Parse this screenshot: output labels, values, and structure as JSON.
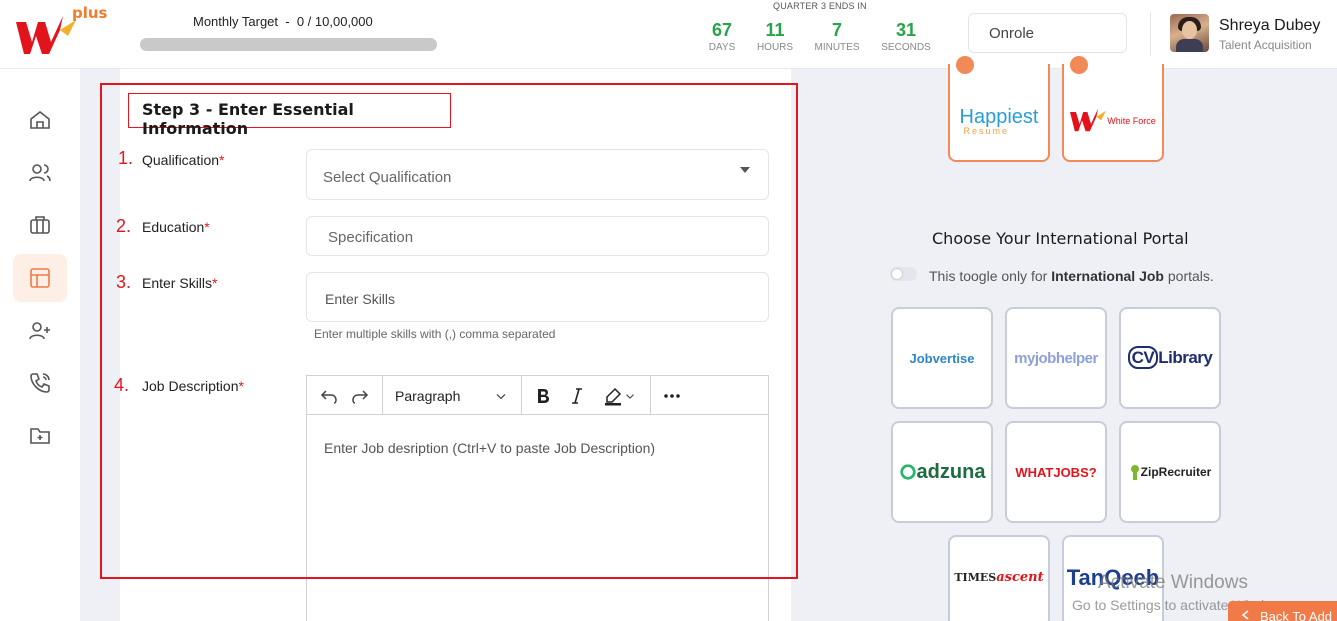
{
  "header": {
    "logo_plus": "plus",
    "target_label": "Monthly Target",
    "target_separator": "-",
    "target_value": "0 / 10,00,000",
    "target_progress": 0,
    "quarter_label": "QUARTER 3 ENDS IN",
    "countdown": [
      {
        "value": "67",
        "unit": "DAYS"
      },
      {
        "value": "11",
        "unit": "HOURS"
      },
      {
        "value": "7",
        "unit": "MINUTES"
      },
      {
        "value": "31",
        "unit": "SECONDS"
      }
    ],
    "search_text": "Onrole",
    "user_name": "Shreya Dubey",
    "user_role": "Talent Acquisition"
  },
  "sidebar": {
    "items": [
      {
        "icon": "home-icon"
      },
      {
        "icon": "users-icon"
      },
      {
        "icon": "briefcase-icon"
      },
      {
        "icon": "layout-icon",
        "active": true
      },
      {
        "icon": "user-plus-icon"
      },
      {
        "icon": "phone-icon"
      },
      {
        "icon": "folder-plus-icon"
      }
    ]
  },
  "form": {
    "step_title": "Step 3 - Enter Essential Information",
    "fields": [
      {
        "num": "1.",
        "label": "Qualification",
        "placeholder": "Select Qualification"
      },
      {
        "num": "2.",
        "label": "Education",
        "placeholder": "Specification"
      },
      {
        "num": "3.",
        "label": "Enter Skills",
        "placeholder": "Enter Skills"
      },
      {
        "num": "4.",
        "label": "Job Description"
      }
    ],
    "required_mark": "*",
    "skills_hint": "Enter multiple skills with (,) comma separated",
    "editor": {
      "paragraph_label": "Paragraph",
      "placeholder": "Enter Job desription (Ctrl+V to paste Job Description)"
    }
  },
  "portals": {
    "top_cards": [
      "Happiest Resume",
      "White Force"
    ],
    "happiest_main": "Happiest",
    "happiest_sub": "Resume",
    "whiteforce_text": "White Force",
    "international_title": "Choose Your International Portal",
    "toggle_text_pre": "This toogle only for",
    "toggle_text_bold": "International Job",
    "toggle_text_post": "portals.",
    "international": [
      "Jobvertise",
      "myjobhelper",
      "CVLibrary",
      "adzuna",
      "WHATJOBS?",
      "ZipRecruiter",
      "TIMES ascent",
      "TanQeeb"
    ],
    "cv_prefix": "CV",
    "cv_suffix": "Library",
    "adzuna_text": "adzuna",
    "times_prefix": "TIMES",
    "times_suffix": "ascent",
    "colors": {
      "orange_border": "#f28a57",
      "grey_border": "#c7ccda"
    }
  },
  "watermark": {
    "line1": "Activate Windows",
    "line2": "Go to Settings to activate Windows."
  },
  "back_button": "Back To Add",
  "colors": {
    "accent_red": "#e1161f",
    "countdown_green": "#27a34a",
    "orange": "#f07a48"
  }
}
